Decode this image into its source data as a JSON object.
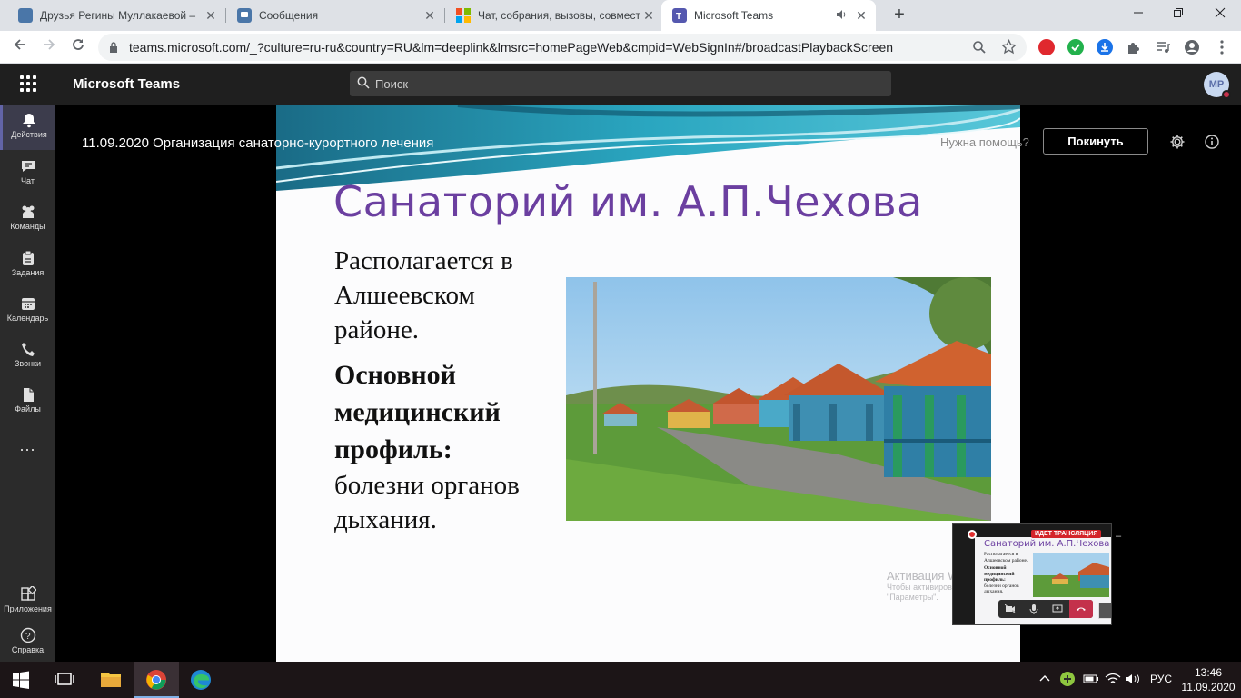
{
  "browser": {
    "tabs": [
      {
        "title": "Друзья Регины Муллакаевой –",
        "icon": "vk-icon",
        "active": false
      },
      {
        "title": "Сообщения",
        "icon": "vk-messages-icon",
        "active": false
      },
      {
        "title": "Чат, собрания, вызовы, совмест",
        "icon": "microsoft-icon",
        "active": false
      },
      {
        "title": "Microsoft Teams",
        "icon": "teams-icon",
        "active": true
      }
    ],
    "close_glyph": "✕",
    "new_tab_glyph": "+",
    "url": "teams.microsoft.com/_?culture=ru-ru&country=RU&lm=deeplink&lmsrc=homePageWeb&cmpid=WebSignIn#/broadcastPlaybackScreen"
  },
  "teams": {
    "app_title": "Microsoft Teams",
    "search_placeholder": "Поиск",
    "avatar_initials": "MP",
    "rail": [
      {
        "label": "Действия",
        "icon": "bell-icon",
        "active": true
      },
      {
        "label": "Чат",
        "icon": "chat-icon"
      },
      {
        "label": "Команды",
        "icon": "teams-group-icon"
      },
      {
        "label": "Задания",
        "icon": "assignments-icon"
      },
      {
        "label": "Календарь",
        "icon": "calendar-icon"
      },
      {
        "label": "Звонки",
        "icon": "phone-icon"
      },
      {
        "label": "Файлы",
        "icon": "files-icon"
      }
    ],
    "more_label": "...",
    "rail_bottom": [
      {
        "label": "Приложения",
        "icon": "apps-icon"
      },
      {
        "label": "Справка",
        "icon": "help-icon"
      }
    ],
    "meeting": {
      "title": "11.09.2020 Организация санаторно-курортного лечения",
      "help_link": "Нужна помощь?",
      "leave_button": "Покинуть"
    }
  },
  "slide": {
    "title": "Санаторий им. А.П.Чехова",
    "line1": "Располагается в Алшеевском районе.",
    "line2": "Основной медицинский профиль:",
    "line3": "болезни органов дыхания."
  },
  "watermark": {
    "line1": "Активация Wind",
    "line2": "Чтобы активировать",
    "line3": "\"Параметры\"."
  },
  "pip": {
    "live_badge": "ИДЕТ ТРАНСЛЯЦИЯ",
    "title": "Санаторий им. А.П.Чехова",
    "body1": "Располагается в Алшеевском районе.",
    "body2": "Основной медицинский профиль:",
    "body3": "болезни органов дыхания."
  },
  "taskbar": {
    "language": "РУС",
    "time": "13:46",
    "date": "11.09.2020"
  },
  "colors": {
    "teams_accent": "#6264a7",
    "slide_title": "#6b3fa0",
    "live_red": "#d4252a"
  }
}
